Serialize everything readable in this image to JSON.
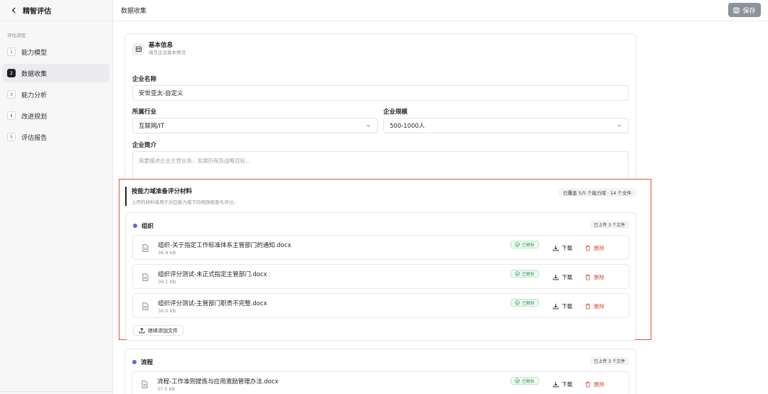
{
  "sidebar": {
    "title": "精智评估",
    "section_label": "评估流程",
    "items": [
      {
        "num": "1",
        "label": "能力模型"
      },
      {
        "num": "2",
        "label": "数据收集"
      },
      {
        "num": "3",
        "label": "能力分析"
      },
      {
        "num": "4",
        "label": "改进规划"
      },
      {
        "num": "5",
        "label": "评估报告"
      }
    ]
  },
  "topbar": {
    "title": "数据收集",
    "save_label": "保存"
  },
  "basic_info": {
    "title": "基本信息",
    "subtitle": "填写企业基本情况",
    "company_name_label": "企业名称",
    "company_name_value": "安世亚太-自定义",
    "industry_label": "所属行业",
    "industry_value": "互联网/IT",
    "scale_label": "企业规模",
    "scale_value": "500-1000人",
    "intro_label": "企业简介",
    "intro_placeholder": "简要描述企业主营业务、发展历程及战略目标..."
  },
  "materials": {
    "title": "按能力域准备评分材料",
    "subtitle": "上传的材料将用于对应能力域下的规则核查与评分。",
    "coverage": "已覆盖 5/5 个能力域 · 14 个文件",
    "parsed_label": "已解析",
    "download_label": "下载",
    "delete_label": "删除",
    "add_label": "继续添加文件",
    "domains": [
      {
        "name": "组织",
        "badge": "已上传 3 个文件",
        "files": [
          {
            "name": "组织-关于指定工作标准体系主管部门的通知.docx",
            "size": "36.9 KB"
          },
          {
            "name": "组织评分测试-未正式指定主管部门.docx",
            "size": "36.1 KB"
          },
          {
            "name": "组织评分测试-主管部门职责不完整.docx",
            "size": "36.0 KB"
          }
        ]
      },
      {
        "name": "流程",
        "badge": "已上传 3 个文件",
        "files": [
          {
            "name": "流程-工作准则提炼与应用激励管理办法.docx",
            "size": "37.5 KB"
          }
        ]
      }
    ]
  },
  "colors": {
    "highlight_border": "#e0533a",
    "domain_dot": "#5b67e6",
    "parsed_green": "#2d9a4e",
    "delete_red": "#d94a3c",
    "save_button": "#8e9299"
  }
}
